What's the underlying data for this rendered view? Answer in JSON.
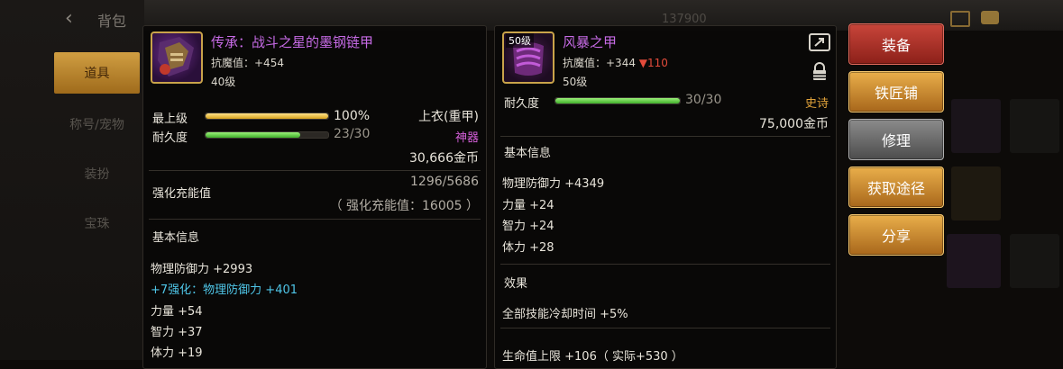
{
  "background": {
    "back_arrow": "‹",
    "bag_title": "背包",
    "side_tabs": [
      "道具",
      "称号/宠物",
      "装扮",
      "宝珠"
    ],
    "topbar_number": "137900"
  },
  "left_item": {
    "name": "传承：战斗之星的墨钢链甲",
    "magic_resist": "抗魔值：+454",
    "level": "40级",
    "tier_label": "最上级",
    "tier_value": "100%",
    "tier_progress": 1.0,
    "durability_label": "耐久度",
    "durability_value": "23/30",
    "durability_progress": 0.77,
    "slot": "上衣(重甲)",
    "rarity": "神器",
    "price": "30,666金币",
    "enhance_label": "强化充能值",
    "enhance_value": "1296/5686",
    "enhance_note": "（ 强化充能值：16005 ）",
    "basic_info_title": "基本信息",
    "stats": [
      {
        "text": "物理防御力 +2993",
        "color": "normal"
      },
      {
        "text": "+7强化：物理防御力 +401",
        "color": "cyan"
      },
      {
        "text": "力量 +54",
        "color": "normal"
      },
      {
        "text": "智力 +37",
        "color": "normal"
      },
      {
        "text": "体力 +19",
        "color": "normal"
      }
    ]
  },
  "right_item": {
    "level_tag": "50级",
    "name": "风暴之甲",
    "magic_resist": "抗魔值：+344",
    "resist_diff": "▼110",
    "level": "50级",
    "durability_label": "耐久度",
    "durability_value": "30/30",
    "durability_progress": 1.0,
    "rarity": "史诗",
    "price": "75,000金币",
    "basic_info_title": "基本信息",
    "stats": [
      "物理防御力 +4349",
      "力量 +24",
      "智力 +24",
      "体力 +28"
    ],
    "effect_title": "效果",
    "effects": [
      "全部技能冷却时间 +5%",
      "生命值上限 +106（ 实际+530 ）"
    ]
  },
  "buttons": {
    "equip": "装备",
    "blacksmith": "铁匠铺",
    "repair": "修理",
    "obtain": "获取途径",
    "share": "分享"
  },
  "colors": {
    "purple_name": "#c76be6",
    "cyan": "#4fc6e8",
    "gold": "#e0a23a",
    "red": "#e34b3b"
  }
}
